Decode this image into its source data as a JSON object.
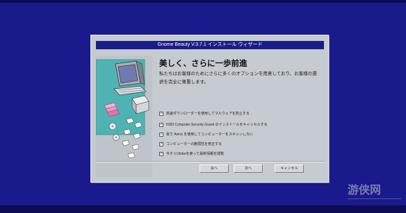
{
  "window": {
    "title": "Gnome Beauty V.3.7.1 インストール ウィザード"
  },
  "main": {
    "heading": "美しく、さらに一歩前進",
    "description": "私たちはお客様のためにさらに多くのオプションを用意しており、お客様の選択を完全に尊重します。"
  },
  "options": [
    {
      "label": "高速ダウンローダーを使用してマルウェアを防止する",
      "checked": true,
      "mark": "✓"
    },
    {
      "label": "6283 Computer Security Guard のインストールをキャンセルする",
      "checked": true,
      "mark": "✓"
    },
    {
      "label": "後で Avina を使用してコンピューターをスキャンしない",
      "checked": true,
      "mark": "✓"
    },
    {
      "label": "コンピューターの脆弱性を修正する",
      "checked": true,
      "mark": "✓"
    },
    {
      "label": "今すぐUtobeを使って最新情報を閲覧",
      "checked": true,
      "mark": "✓"
    }
  ],
  "buttons": {
    "back": "戻へ",
    "next": "次へ",
    "cancel": "キャンセル"
  },
  "watermark": {
    "text": "游侠网"
  },
  "colors": {
    "desktop": "#1a1a8c",
    "titlebar": "#1a1d86",
    "dialog": "#c6cbd1",
    "illustration_accent": "#4fb3b3"
  },
  "icons": {
    "illustration": "computer-install-illustration",
    "checkbox": "check-icon"
  }
}
